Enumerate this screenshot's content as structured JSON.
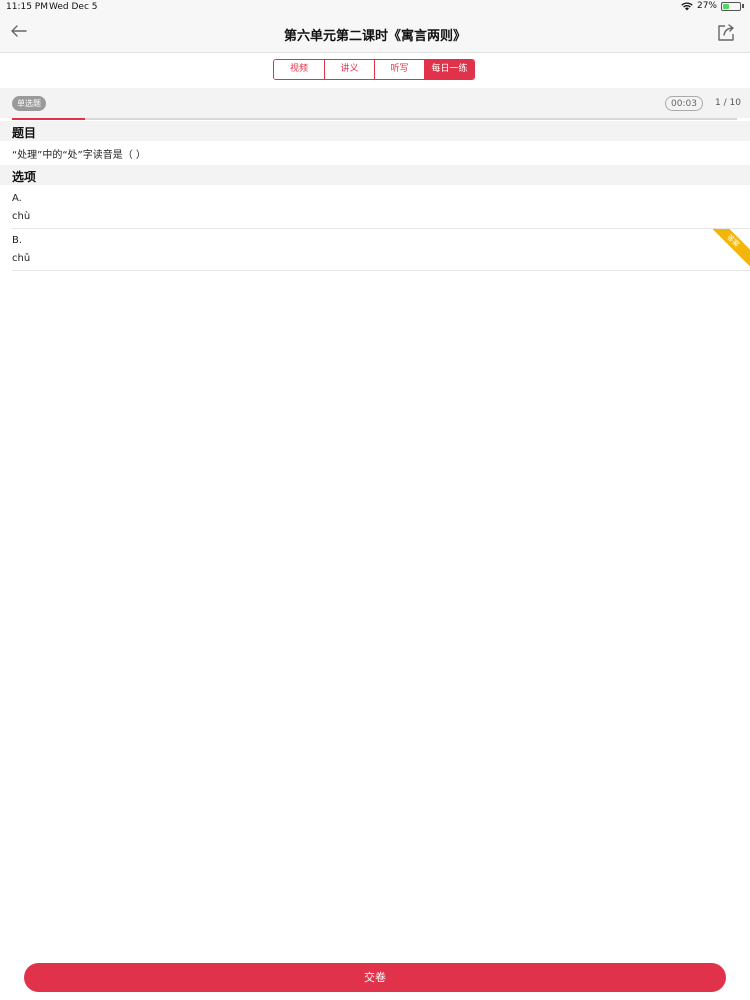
{
  "status_bar": {
    "time": "11:15 PM",
    "date": "Wed Dec 5",
    "battery": "27%"
  },
  "nav": {
    "title": "第六单元第二课时《寓言两则》",
    "back_icon": "back-arrow-icon",
    "share_icon": "share-icon"
  },
  "tabs": [
    {
      "label": "视频",
      "active": false
    },
    {
      "label": "讲义",
      "active": false
    },
    {
      "label": "听写",
      "active": false
    },
    {
      "label": "每日一练",
      "active": true
    }
  ],
  "quiz": {
    "type_label": "单选题",
    "timer": "00:03",
    "progress_text": "1 / 10",
    "progress_fraction": 0.1
  },
  "question": {
    "heading": "题目",
    "text": "“处理”中的“处”字读音是（ ）"
  },
  "options_section": {
    "heading": "选项",
    "items": [
      {
        "key": "A.",
        "value": "chù",
        "ribbon": ""
      },
      {
        "key": "B.",
        "value": "chǔ",
        "ribbon": "答案"
      }
    ]
  },
  "submit_label": "交卷",
  "colors": {
    "accent": "#e0334b",
    "ribbon": "#f2b50c"
  }
}
